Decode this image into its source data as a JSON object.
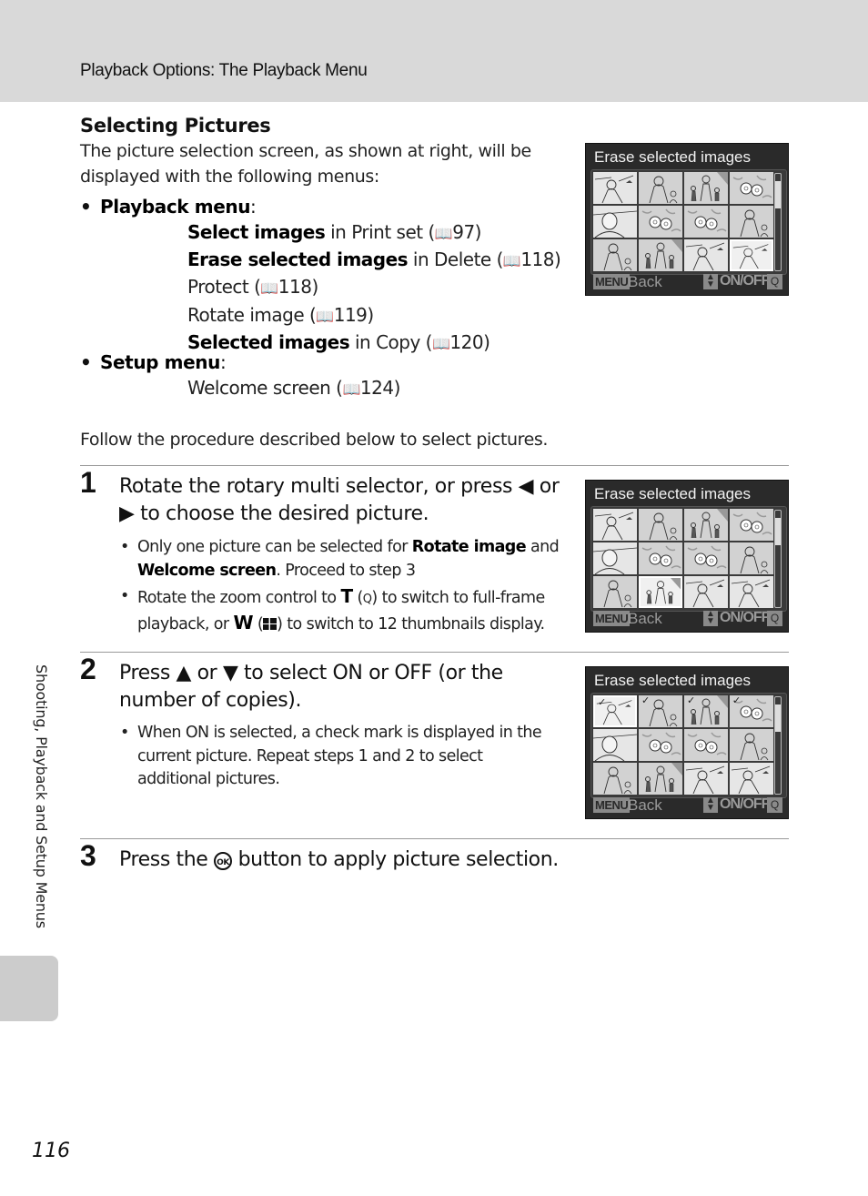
{
  "header": {
    "title": "Playback Options: The Playback Menu"
  },
  "section": {
    "heading": "Selecting Pictures",
    "intro": "The picture selection screen, as shown at right, will be displayed with the following menus:",
    "book_icon": "book-reference-icon",
    "menus": [
      {
        "name": "Playback menu",
        "items": [
          {
            "bold": "Select images",
            "rest": " in Print set (",
            "ref": "97",
            "close": ")"
          },
          {
            "bold": "Erase selected images",
            "rest": " in Delete (",
            "ref": "118",
            "close": ")"
          },
          {
            "bold": "",
            "rest": "Protect (",
            "ref": "118",
            "close": ")"
          },
          {
            "bold": "",
            "rest": "Rotate image (",
            "ref": "119",
            "close": ")"
          },
          {
            "bold": "Selected images",
            "rest": " in Copy (",
            "ref": "120",
            "close": ")"
          }
        ]
      },
      {
        "name": "Setup menu",
        "items": [
          {
            "bold": "",
            "rest": "Welcome screen (",
            "ref": "124",
            "close": ")"
          }
        ]
      }
    ],
    "follow": "Follow the procedure described below to select pictures."
  },
  "steps": [
    {
      "num": "1",
      "title_a": "Rotate the rotary multi selector, or press ",
      "title_icon1": "◀",
      "title_b": " or ",
      "title_icon2": "▶",
      "title_c": " to choose the desired picture.",
      "bullets": [
        {
          "a": "Only one picture can be selected for ",
          "b1": "Rotate image",
          "c": " and ",
          "b2": "Welcome screen",
          "d": ". Proceed to step 3"
        },
        {
          "a": "Rotate the zoom control to ",
          "b1": "T",
          "c": " (",
          "icon1": "🔍",
          "d": ") to switch to full-frame playback, or ",
          "b2": "W",
          "e": " (",
          "icon2": "▦",
          "f": ") to switch to 12 thumbnails display."
        }
      ]
    },
    {
      "num": "2",
      "title_a": "Press ",
      "title_icon1": "▲",
      "title_b": " or ",
      "title_icon2": "▼",
      "title_c": " to select ON or OFF (or the number of copies).",
      "bullets": [
        {
          "text": "When ON is selected, a check mark is displayed in the current picture. Repeat steps 1 and 2 to select additional pictures."
        }
      ]
    },
    {
      "num": "3",
      "title_a": "Press the ",
      "title_icon1": "Ⓚ",
      "title_b": " button to apply picture selection."
    }
  ],
  "camera_screens": [
    {
      "title": "Erase selected images",
      "selected_index": 11,
      "checked": [],
      "menu_key": "MENU",
      "back": "Back",
      "updown_key": "▲▼",
      "onoff": "ON/OFF",
      "zoom_key": "Q"
    },
    {
      "title": "Erase selected images",
      "selected_index": 9,
      "checked": [],
      "menu_key": "MENU",
      "back": "Back",
      "updown_key": "▲▼",
      "onoff": "ON/OFF",
      "zoom_key": "Q"
    },
    {
      "title": "Erase selected images",
      "selected_index": 0,
      "checked": [
        0,
        1,
        2,
        3
      ],
      "menu_key": "MENU",
      "back": "Back",
      "updown_key": "▲▼",
      "onoff": "ON/OFF",
      "zoom_key": "Q"
    }
  ],
  "sidebar": {
    "tab_label": "Shooting, Playback and Setup Menus"
  },
  "footer": {
    "page_number": "116"
  }
}
